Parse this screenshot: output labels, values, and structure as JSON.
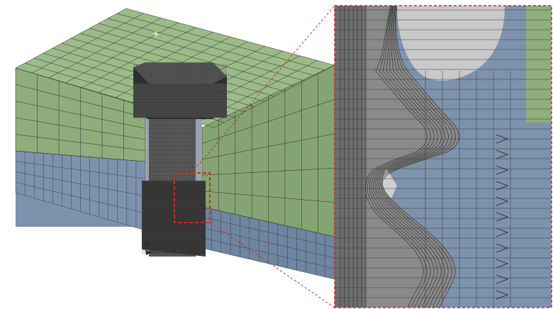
{
  "figure": {
    "subject": "bolted-joint-mesh",
    "colors": {
      "top_plate": "#8fae7c",
      "top_plate_face": "#9bbb88",
      "top_plate_side": "#85a473",
      "bottom_plate": "#7d93ad",
      "bottom_plate_side": "#6f86a2",
      "bolt": "#5a5a5a",
      "bolt_dark": "#2f2f2f",
      "bolt_light": "#c6c6c6",
      "mesh_line": "#2a2a2a",
      "zoom_marker": "#d9241c",
      "background": "#ffffff"
    }
  }
}
